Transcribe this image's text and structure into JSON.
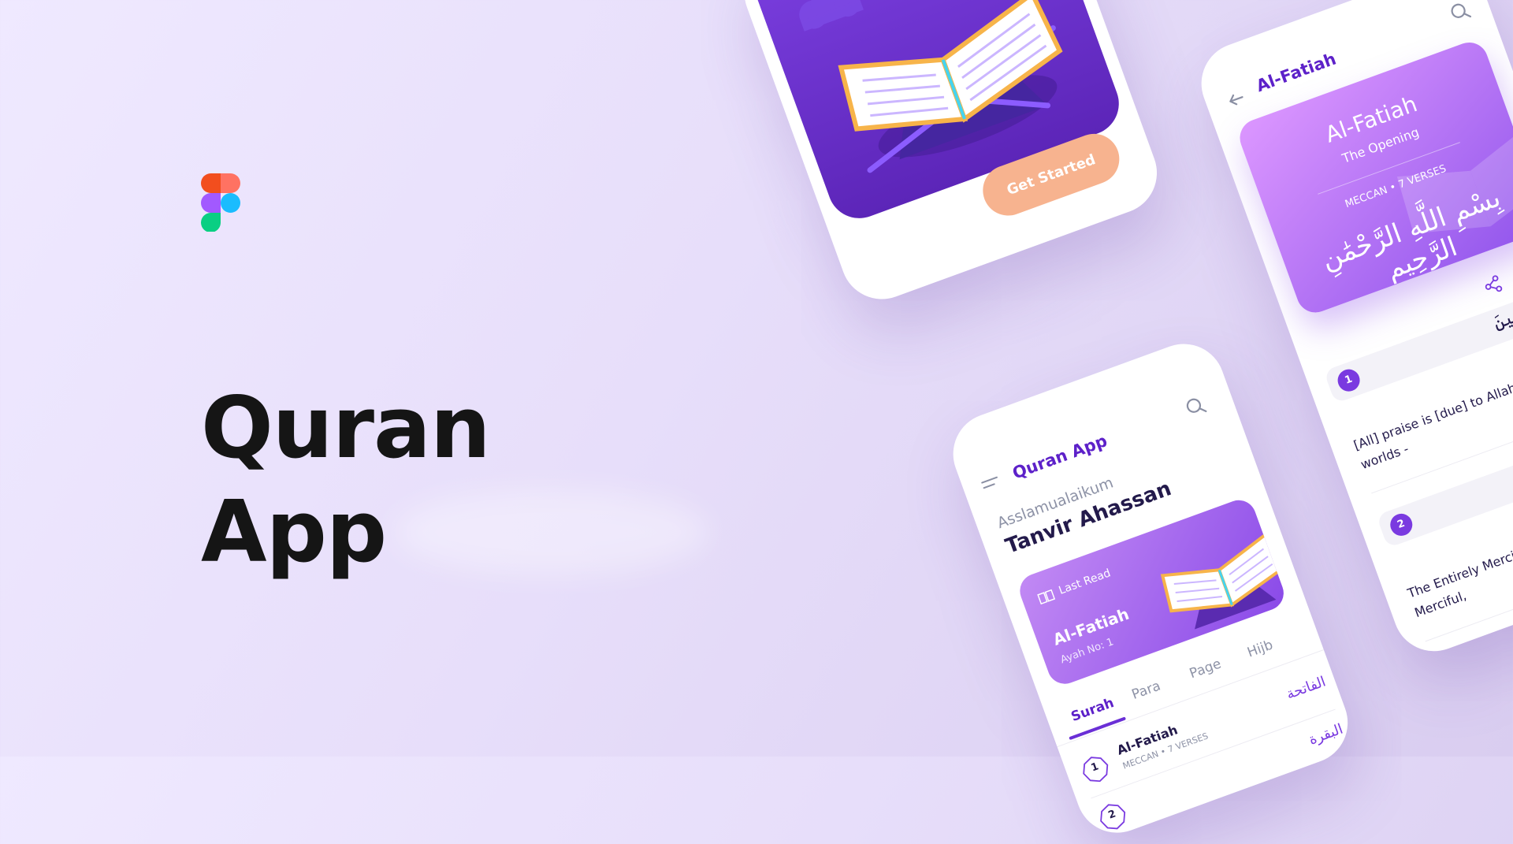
{
  "hero": {
    "title_line1": "Quran",
    "title_line2": "App"
  },
  "colors": {
    "accent": "#5D21C9",
    "cta": "#F7B38F",
    "card_gradient_start": "#C28AF4",
    "card_gradient_end": "#8A4AE8",
    "text_dark": "#231A4B"
  },
  "splash_screen": {
    "cta_label": "Get Started"
  },
  "home_screen": {
    "app_name": "Quran App",
    "greeting": "Asslamualaikum",
    "user_name": "Tanvir Ahassan",
    "last_read": {
      "label": "Last Read",
      "surah": "Al-Fatiah",
      "ayah": "Ayah No: 1"
    },
    "tabs": [
      "Surah",
      "Para",
      "Page",
      "Hijb"
    ],
    "surahs": [
      {
        "number": "1",
        "name": "Al-Fatiah",
        "meta": "MECCAN • 7 VERSES",
        "arabic": "الفاتحة"
      },
      {
        "number": "2",
        "name": "",
        "meta": "",
        "arabic": "البقرة"
      }
    ]
  },
  "surah_screen": {
    "title": "Al-Fatiah",
    "header": {
      "name": "Al-Fatiah",
      "subtitle": "The Opening",
      "meta": "MECCAN • 7 VERSES",
      "bismillah": "بِسْمِ اللَّهِ الرَّحْمَٰنِ الرَّحِيمِ"
    },
    "verses": [
      {
        "number": "1",
        "arabic": "ٱلْعَٰلَمِينَ",
        "translation": "[All] praise is [due] to Allah, Lord of the worlds -"
      },
      {
        "number": "2",
        "arabic": "",
        "translation": "The Entirely Merciful, the Especially Merciful,"
      }
    ]
  }
}
